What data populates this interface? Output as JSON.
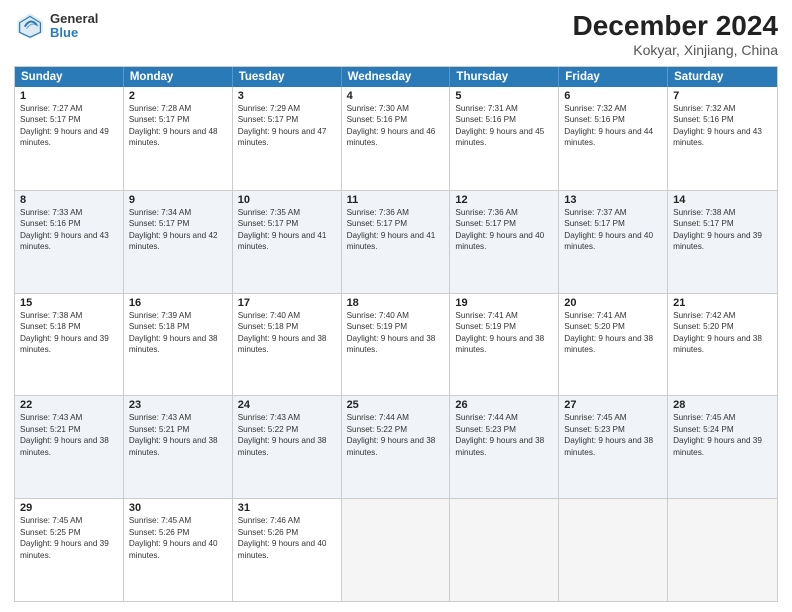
{
  "header": {
    "logo": {
      "line1": "General",
      "line2": "Blue"
    },
    "title": "December 2024",
    "subtitle": "Kokyar, Xinjiang, China"
  },
  "weekdays": [
    "Sunday",
    "Monday",
    "Tuesday",
    "Wednesday",
    "Thursday",
    "Friday",
    "Saturday"
  ],
  "weeks": [
    {
      "alt": false,
      "days": [
        {
          "num": "1",
          "sunrise": "Sunrise: 7:27 AM",
          "sunset": "Sunset: 5:17 PM",
          "daylight": "Daylight: 9 hours and 49 minutes."
        },
        {
          "num": "2",
          "sunrise": "Sunrise: 7:28 AM",
          "sunset": "Sunset: 5:17 PM",
          "daylight": "Daylight: 9 hours and 48 minutes."
        },
        {
          "num": "3",
          "sunrise": "Sunrise: 7:29 AM",
          "sunset": "Sunset: 5:17 PM",
          "daylight": "Daylight: 9 hours and 47 minutes."
        },
        {
          "num": "4",
          "sunrise": "Sunrise: 7:30 AM",
          "sunset": "Sunset: 5:16 PM",
          "daylight": "Daylight: 9 hours and 46 minutes."
        },
        {
          "num": "5",
          "sunrise": "Sunrise: 7:31 AM",
          "sunset": "Sunset: 5:16 PM",
          "daylight": "Daylight: 9 hours and 45 minutes."
        },
        {
          "num": "6",
          "sunrise": "Sunrise: 7:32 AM",
          "sunset": "Sunset: 5:16 PM",
          "daylight": "Daylight: 9 hours and 44 minutes."
        },
        {
          "num": "7",
          "sunrise": "Sunrise: 7:32 AM",
          "sunset": "Sunset: 5:16 PM",
          "daylight": "Daylight: 9 hours and 43 minutes."
        }
      ]
    },
    {
      "alt": true,
      "days": [
        {
          "num": "8",
          "sunrise": "Sunrise: 7:33 AM",
          "sunset": "Sunset: 5:16 PM",
          "daylight": "Daylight: 9 hours and 43 minutes."
        },
        {
          "num": "9",
          "sunrise": "Sunrise: 7:34 AM",
          "sunset": "Sunset: 5:17 PM",
          "daylight": "Daylight: 9 hours and 42 minutes."
        },
        {
          "num": "10",
          "sunrise": "Sunrise: 7:35 AM",
          "sunset": "Sunset: 5:17 PM",
          "daylight": "Daylight: 9 hours and 41 minutes."
        },
        {
          "num": "11",
          "sunrise": "Sunrise: 7:36 AM",
          "sunset": "Sunset: 5:17 PM",
          "daylight": "Daylight: 9 hours and 41 minutes."
        },
        {
          "num": "12",
          "sunrise": "Sunrise: 7:36 AM",
          "sunset": "Sunset: 5:17 PM",
          "daylight": "Daylight: 9 hours and 40 minutes."
        },
        {
          "num": "13",
          "sunrise": "Sunrise: 7:37 AM",
          "sunset": "Sunset: 5:17 PM",
          "daylight": "Daylight: 9 hours and 40 minutes."
        },
        {
          "num": "14",
          "sunrise": "Sunrise: 7:38 AM",
          "sunset": "Sunset: 5:17 PM",
          "daylight": "Daylight: 9 hours and 39 minutes."
        }
      ]
    },
    {
      "alt": false,
      "days": [
        {
          "num": "15",
          "sunrise": "Sunrise: 7:38 AM",
          "sunset": "Sunset: 5:18 PM",
          "daylight": "Daylight: 9 hours and 39 minutes."
        },
        {
          "num": "16",
          "sunrise": "Sunrise: 7:39 AM",
          "sunset": "Sunset: 5:18 PM",
          "daylight": "Daylight: 9 hours and 38 minutes."
        },
        {
          "num": "17",
          "sunrise": "Sunrise: 7:40 AM",
          "sunset": "Sunset: 5:18 PM",
          "daylight": "Daylight: 9 hours and 38 minutes."
        },
        {
          "num": "18",
          "sunrise": "Sunrise: 7:40 AM",
          "sunset": "Sunset: 5:19 PM",
          "daylight": "Daylight: 9 hours and 38 minutes."
        },
        {
          "num": "19",
          "sunrise": "Sunrise: 7:41 AM",
          "sunset": "Sunset: 5:19 PM",
          "daylight": "Daylight: 9 hours and 38 minutes."
        },
        {
          "num": "20",
          "sunrise": "Sunrise: 7:41 AM",
          "sunset": "Sunset: 5:20 PM",
          "daylight": "Daylight: 9 hours and 38 minutes."
        },
        {
          "num": "21",
          "sunrise": "Sunrise: 7:42 AM",
          "sunset": "Sunset: 5:20 PM",
          "daylight": "Daylight: 9 hours and 38 minutes."
        }
      ]
    },
    {
      "alt": true,
      "days": [
        {
          "num": "22",
          "sunrise": "Sunrise: 7:43 AM",
          "sunset": "Sunset: 5:21 PM",
          "daylight": "Daylight: 9 hours and 38 minutes."
        },
        {
          "num": "23",
          "sunrise": "Sunrise: 7:43 AM",
          "sunset": "Sunset: 5:21 PM",
          "daylight": "Daylight: 9 hours and 38 minutes."
        },
        {
          "num": "24",
          "sunrise": "Sunrise: 7:43 AM",
          "sunset": "Sunset: 5:22 PM",
          "daylight": "Daylight: 9 hours and 38 minutes."
        },
        {
          "num": "25",
          "sunrise": "Sunrise: 7:44 AM",
          "sunset": "Sunset: 5:22 PM",
          "daylight": "Daylight: 9 hours and 38 minutes."
        },
        {
          "num": "26",
          "sunrise": "Sunrise: 7:44 AM",
          "sunset": "Sunset: 5:23 PM",
          "daylight": "Daylight: 9 hours and 38 minutes."
        },
        {
          "num": "27",
          "sunrise": "Sunrise: 7:45 AM",
          "sunset": "Sunset: 5:23 PM",
          "daylight": "Daylight: 9 hours and 38 minutes."
        },
        {
          "num": "28",
          "sunrise": "Sunrise: 7:45 AM",
          "sunset": "Sunset: 5:24 PM",
          "daylight": "Daylight: 9 hours and 39 minutes."
        }
      ]
    },
    {
      "alt": false,
      "days": [
        {
          "num": "29",
          "sunrise": "Sunrise: 7:45 AM",
          "sunset": "Sunset: 5:25 PM",
          "daylight": "Daylight: 9 hours and 39 minutes."
        },
        {
          "num": "30",
          "sunrise": "Sunrise: 7:45 AM",
          "sunset": "Sunset: 5:26 PM",
          "daylight": "Daylight: 9 hours and 40 minutes."
        },
        {
          "num": "31",
          "sunrise": "Sunrise: 7:46 AM",
          "sunset": "Sunset: 5:26 PM",
          "daylight": "Daylight: 9 hours and 40 minutes."
        },
        {
          "num": "",
          "sunrise": "",
          "sunset": "",
          "daylight": ""
        },
        {
          "num": "",
          "sunrise": "",
          "sunset": "",
          "daylight": ""
        },
        {
          "num": "",
          "sunrise": "",
          "sunset": "",
          "daylight": ""
        },
        {
          "num": "",
          "sunrise": "",
          "sunset": "",
          "daylight": ""
        }
      ]
    }
  ]
}
